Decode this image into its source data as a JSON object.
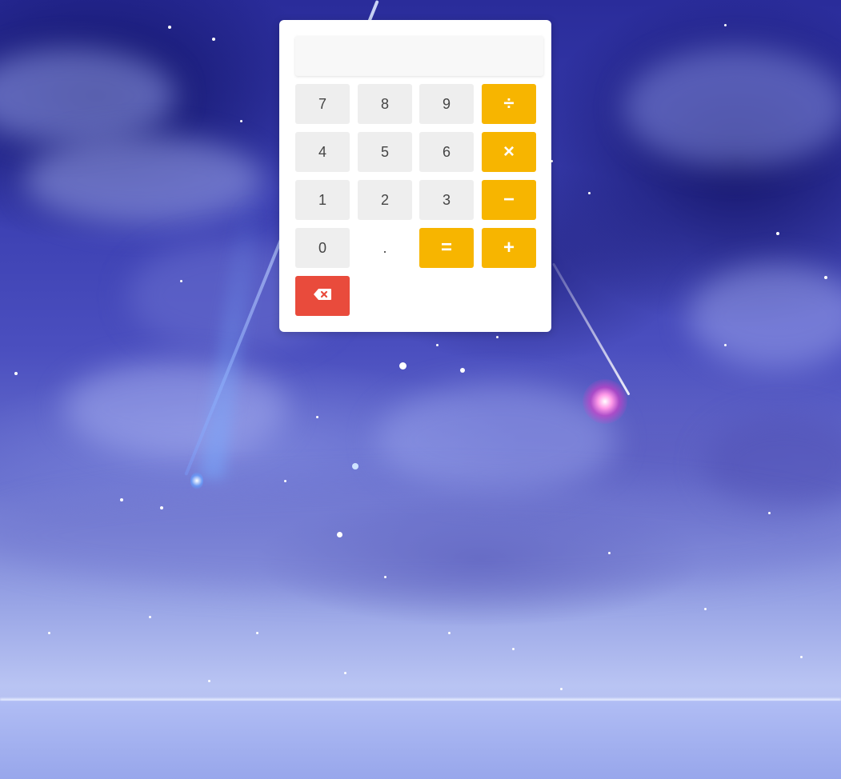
{
  "display": {
    "value": ""
  },
  "keys": {
    "seven": "7",
    "eight": "8",
    "nine": "9",
    "divide": "÷",
    "four": "4",
    "five": "5",
    "six": "6",
    "multiply": "×",
    "one": "1",
    "two": "2",
    "three": "3",
    "subtract": "−",
    "zero": "0",
    "decimal": ".",
    "equals": "=",
    "add": "+"
  },
  "icons": {
    "backspace": "backspace-icon"
  },
  "colors": {
    "number_key": "#eeeeee",
    "operator_key": "#f7b500",
    "delete_key": "#e94b3c",
    "panel": "#ffffff"
  }
}
